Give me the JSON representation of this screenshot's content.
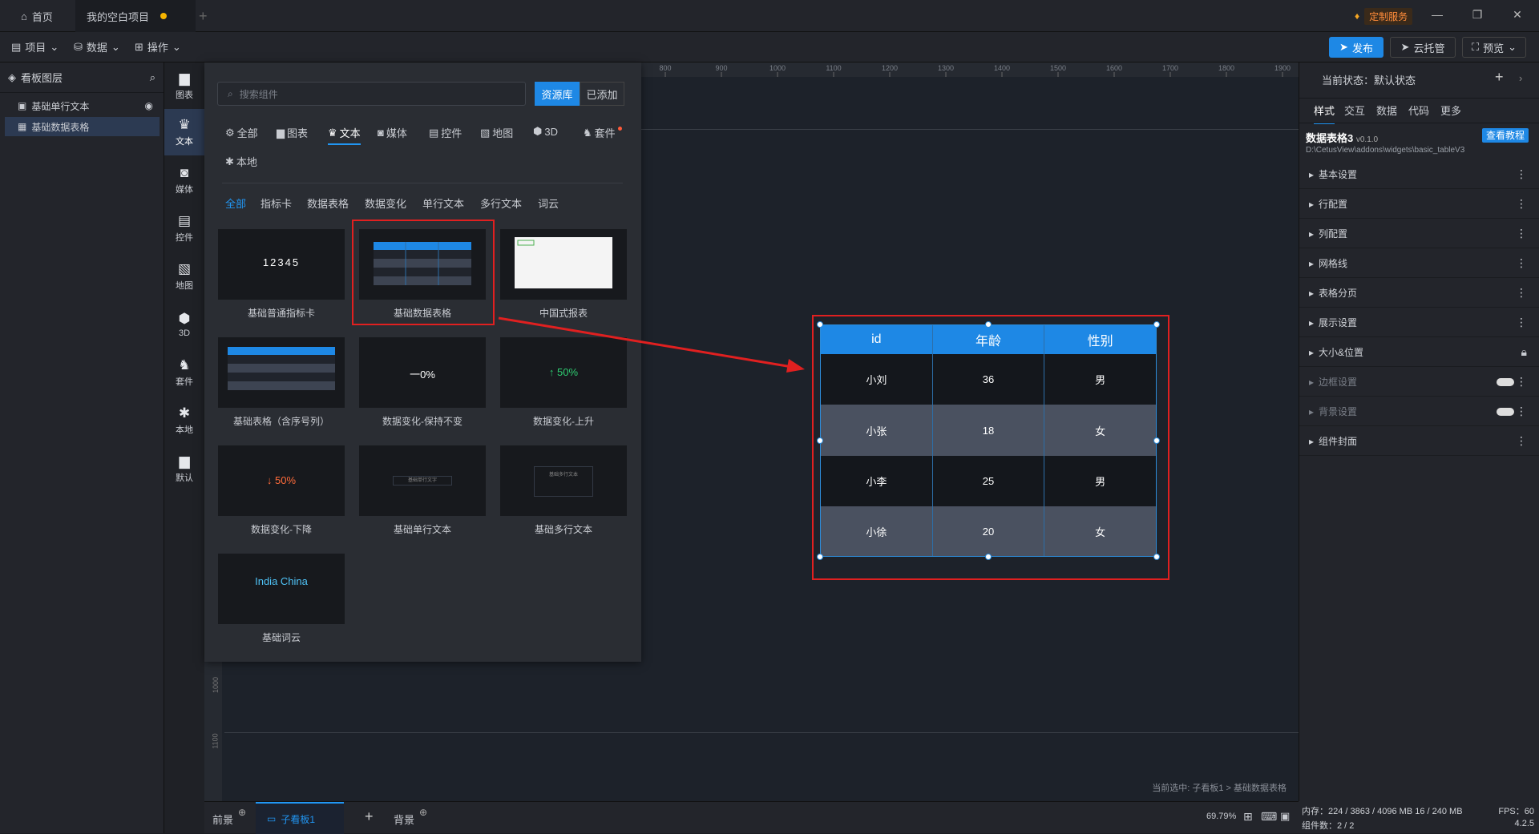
{
  "titlebar": {
    "home_tab": "首页",
    "project_tab": "我的空白项目",
    "custom_service": "定制服务"
  },
  "menubar": {
    "project": "项目",
    "data": "数据",
    "operate": "操作",
    "publish": "发布",
    "cloud_host": "云托管",
    "preview": "预览"
  },
  "layers": {
    "title": "看板图层",
    "items": [
      {
        "label": "基础单行文本"
      },
      {
        "label": "基础数据表格"
      }
    ]
  },
  "iconbar": [
    {
      "label": "图表",
      "icon": "chart-icon"
    },
    {
      "label": "文本",
      "icon": "text-icon"
    },
    {
      "label": "媒体",
      "icon": "media-icon"
    },
    {
      "label": "控件",
      "icon": "control-icon"
    },
    {
      "label": "地图",
      "icon": "map-icon"
    },
    {
      "label": "3D",
      "icon": "cube-icon"
    },
    {
      "label": "套件",
      "icon": "kit-icon"
    },
    {
      "label": "本地",
      "icon": "puzzle-icon"
    },
    {
      "label": "默认",
      "icon": "default-icon"
    }
  ],
  "popup": {
    "search_placeholder": "搜索组件",
    "tab_library": "资源库",
    "tab_added": "已添加",
    "categories": [
      "全部",
      "图表",
      "文本",
      "媒体",
      "控件",
      "地图",
      "3D",
      "套件",
      "本地"
    ],
    "subcategories": [
      "全部",
      "指标卡",
      "数据表格",
      "数据变化",
      "单行文本",
      "多行文本",
      "词云"
    ],
    "cards": [
      {
        "label": "基础普通指标卡",
        "preview": "12345"
      },
      {
        "label": "基础数据表格",
        "preview": ""
      },
      {
        "label": "中国式报表",
        "preview": ""
      },
      {
        "label": "基础表格（含序号列）",
        "preview": ""
      },
      {
        "label": "数据变化-保持不变",
        "preview": "一0%"
      },
      {
        "label": "数据变化-上升",
        "preview": "↑ 50%"
      },
      {
        "label": "数据变化-下降",
        "preview": "↓ 50%"
      },
      {
        "label": "基础单行文本",
        "preview": "基础单行文字"
      },
      {
        "label": "基础多行文本",
        "preview": "基础多行文本"
      },
      {
        "label": "基础词云",
        "preview": "India China"
      }
    ]
  },
  "ruler": {
    "ticks": [
      "800",
      "900",
      "1000",
      "1100",
      "1200",
      "1300",
      "1400",
      "1500",
      "1600",
      "1700",
      "1800",
      "1900"
    ],
    "left_ticks": [
      "1000",
      "1100"
    ]
  },
  "table": {
    "headers": [
      "id",
      "年龄",
      "性别"
    ],
    "rows": [
      [
        "小刘",
        "36",
        "男"
      ],
      [
        "小张",
        "18",
        "女"
      ],
      [
        "小李",
        "25",
        "男"
      ],
      [
        "小徐",
        "20",
        "女"
      ]
    ],
    "header_color": "#1e88e5"
  },
  "canvas": {
    "selection_info": "当前选中: 子看板1 > 基础数据表格"
  },
  "rpanel": {
    "current_state": "当前状态：默认状态",
    "tabs": [
      "样式",
      "交互",
      "数据",
      "代码",
      "更多"
    ],
    "widget_name": "数据表格3",
    "version": "v0.1.0",
    "tutorial": "查看教程",
    "path": "D:\\CetusView\\addons\\widgets\\basic_tableV3",
    "sections": [
      "基本设置",
      "行配置",
      "列配置",
      "网格线",
      "表格分页",
      "展示设置",
      "大小&位置",
      "边框设置",
      "背景设置",
      "组件封面"
    ]
  },
  "bottom": {
    "front": "前景",
    "subboard": "子看板1",
    "back": "背景",
    "zoom": "69.79%"
  },
  "status": {
    "memory": "内存：224 / 3863 / 4096 MB  16 / 240 MB",
    "fps": "FPS：60",
    "count": "组件数：2 / 2",
    "version": "4.2.5"
  }
}
